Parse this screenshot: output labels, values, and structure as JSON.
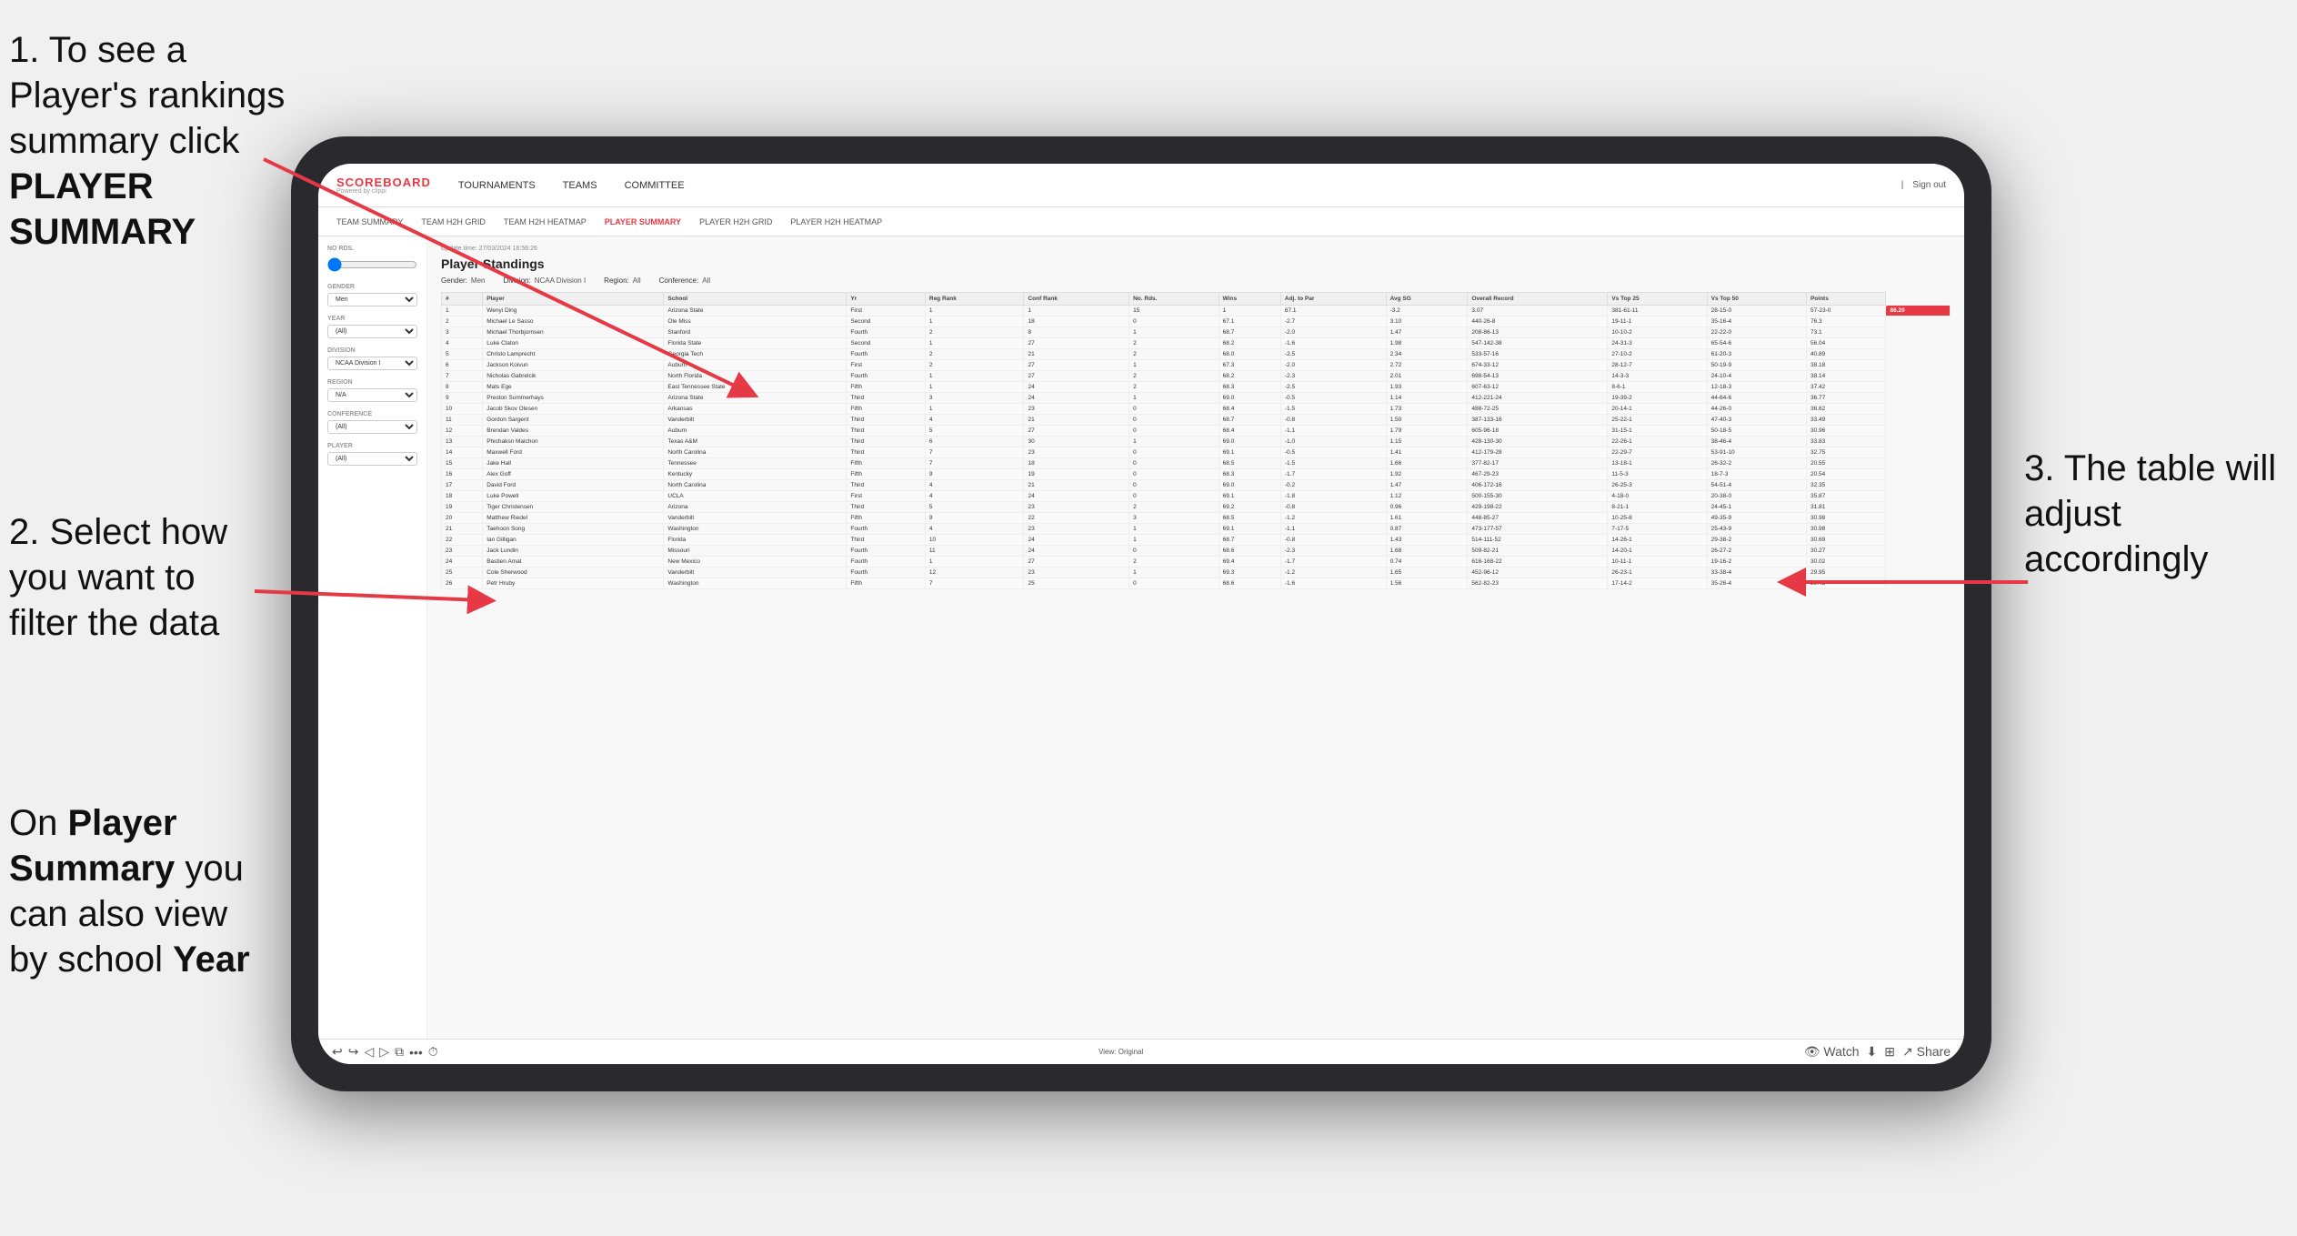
{
  "page": {
    "background": "#f0f0f0"
  },
  "annotations": {
    "top_left": {
      "number": "1.",
      "text": "To see a Player's rankings summary click ",
      "bold": "PLAYER SUMMARY"
    },
    "middle_left": {
      "number": "2.",
      "text": "Select how you want to filter the data"
    },
    "bottom_left": {
      "text": "On ",
      "bold1": "Player Summary",
      "text2": " you can also view by school ",
      "bold2": "Year"
    },
    "right": {
      "number": "3.",
      "text": "The table will adjust accordingly"
    }
  },
  "nav": {
    "logo_top": "SCOREBOARD",
    "logo_bottom": "Powered by clippi",
    "items": [
      "TOURNAMENTS",
      "TEAMS",
      "COMMITTEE"
    ],
    "right_items": [
      "Sign out"
    ],
    "separator": "|"
  },
  "sub_nav": {
    "items": [
      "TEAM SUMMARY",
      "TEAM H2H GRID",
      "TEAM H2H HEATMAP",
      "PLAYER SUMMARY",
      "PLAYER H2H GRID",
      "PLAYER H2H HEATMAP"
    ],
    "active": "PLAYER SUMMARY"
  },
  "sidebar": {
    "no_rds_label": "No Rds.",
    "gender_label": "Gender",
    "gender_value": "Men",
    "year_label": "Year",
    "year_value": "(All)",
    "division_label": "Division",
    "division_value": "NCAA Division I",
    "region_label": "Region",
    "region_value": "N/A",
    "conference_label": "Conference",
    "conference_value": "(All)",
    "player_label": "Player",
    "player_value": "(All)"
  },
  "main": {
    "update_time": "Update time: 27/03/2024 16:56:26",
    "title": "Player Standings",
    "filters": {
      "gender_label": "Gender:",
      "gender_value": "Men",
      "division_label": "Division:",
      "division_value": "NCAA Division I",
      "region_label": "Region:",
      "region_value": "All",
      "conference_label": "Conference:",
      "conference_value": "All"
    },
    "table": {
      "columns": [
        "#",
        "Player",
        "School",
        "Yr",
        "Reg Rank",
        "Conf Rank",
        "No. Rds.",
        "Wins",
        "Adj. to Par",
        "Avg SG",
        "Overall Record",
        "Vs Top 25",
        "Vs Top 50",
        "Points"
      ],
      "rows": [
        [
          "1",
          "Wenyi Ding",
          "Arizona State",
          "First",
          "1",
          "1",
          "15",
          "1",
          "67.1",
          "-3.2",
          "3.07",
          "381-61-11",
          "28-15-0",
          "57-23-0",
          "86.20"
        ],
        [
          "2",
          "Michael Le Sasso",
          "Ole Miss",
          "Second",
          "1",
          "18",
          "0",
          "67.1",
          "-2.7",
          "3.10",
          "440-26-8",
          "19-11-1",
          "35-16-4",
          "76.3"
        ],
        [
          "3",
          "Michael Thorbjornsen",
          "Stanford",
          "Fourth",
          "2",
          "8",
          "1",
          "68.7",
          "-2.0",
          "1.47",
          "208-86-13",
          "10-10-2",
          "22-22-0",
          "73.1"
        ],
        [
          "4",
          "Luke Claton",
          "Florida State",
          "Second",
          "1",
          "27",
          "2",
          "68.2",
          "-1.6",
          "1.98",
          "547-142-38",
          "24-31-3",
          "65-54-6",
          "56.04"
        ],
        [
          "5",
          "Christo Lamprecht",
          "Georgia Tech",
          "Fourth",
          "2",
          "21",
          "2",
          "68.0",
          "-2.5",
          "2.34",
          "533-57-16",
          "27-10-2",
          "61-20-3",
          "40.89"
        ],
        [
          "6",
          "Jackson Koivun",
          "Auburn",
          "First",
          "2",
          "27",
          "1",
          "67.3",
          "-2.0",
          "2.72",
          "674-33-12",
          "28-12-7",
          "50-19-9",
          "38.18"
        ],
        [
          "7",
          "Nicholas Gabrelcik",
          "North Florida",
          "Fourth",
          "1",
          "27",
          "2",
          "68.2",
          "-2.3",
          "2.01",
          "698-54-13",
          "14-3-3",
          "24-10-4",
          "38.14"
        ],
        [
          "8",
          "Mats Ege",
          "East Tennessee State",
          "Fifth",
          "1",
          "24",
          "2",
          "68.3",
          "-2.5",
          "1.93",
          "607-63-12",
          "8-6-1",
          "12-18-3",
          "37.42"
        ],
        [
          "9",
          "Preston Summerhays",
          "Arizona State",
          "Third",
          "3",
          "24",
          "1",
          "69.0",
          "-0.5",
          "1.14",
          "412-221-24",
          "19-39-2",
          "44-64-6",
          "36.77"
        ],
        [
          "10",
          "Jacob Skov Olesen",
          "Arkansas",
          "Fifth",
          "1",
          "23",
          "0",
          "68.4",
          "-1.5",
          "1.73",
          "488-72-25",
          "20-14-1",
          "44-26-0",
          "36.62"
        ],
        [
          "11",
          "Gordon Sargent",
          "Vanderbilt",
          "Third",
          "4",
          "21",
          "0",
          "68.7",
          "-0.8",
          "1.50",
          "387-133-16",
          "25-22-1",
          "47-40-3",
          "33.49"
        ],
        [
          "12",
          "Brendan Valdes",
          "Auburn",
          "Third",
          "5",
          "27",
          "0",
          "68.4",
          "-1.1",
          "1.79",
          "605-96-18",
          "31-15-1",
          "50-18-5",
          "30.96"
        ],
        [
          "13",
          "Phichaksn Maichon",
          "Texas A&M",
          "Third",
          "6",
          "30",
          "1",
          "69.0",
          "-1.0",
          "1.15",
          "428-130-30",
          "22-26-1",
          "38-46-4",
          "33.83"
        ],
        [
          "14",
          "Maxwell Ford",
          "North Carolina",
          "Third",
          "7",
          "23",
          "0",
          "69.1",
          "-0.5",
          "1.41",
          "412-179-28",
          "22-29-7",
          "53-91-10",
          "32.75"
        ],
        [
          "15",
          "Jake Hall",
          "Tennessee",
          "Fifth",
          "7",
          "18",
          "0",
          "68.5",
          "-1.5",
          "1.66",
          "377-82-17",
          "13-18-1",
          "26-32-2",
          "20.55"
        ],
        [
          "16",
          "Alex Goff",
          "Kentucky",
          "Fifth",
          "9",
          "19",
          "0",
          "68.3",
          "-1.7",
          "1.92",
          "467-29-23",
          "11-5-3",
          "18-7-3",
          "20.54"
        ],
        [
          "17",
          "David Ford",
          "North Carolina",
          "Third",
          "4",
          "21",
          "0",
          "69.0",
          "-0.2",
          "1.47",
          "406-172-16",
          "26-25-3",
          "54-51-4",
          "32.35"
        ],
        [
          "18",
          "Luke Powell",
          "UCLA",
          "First",
          "4",
          "24",
          "0",
          "69.1",
          "-1.8",
          "1.12",
          "500-155-30",
          "4-18-0",
          "20-38-0",
          "35.87"
        ],
        [
          "19",
          "Tiger Christensen",
          "Arizona",
          "Third",
          "5",
          "23",
          "2",
          "69.2",
          "-0.8",
          "0.96",
          "429-198-22",
          "8-21-1",
          "24-45-1",
          "31.81"
        ],
        [
          "20",
          "Matthew Riedel",
          "Vanderbilt",
          "Fifth",
          "9",
          "22",
          "3",
          "68.5",
          "-1.2",
          "1.61",
          "448-85-27",
          "10-25-8",
          "49-35-9",
          "30.98"
        ],
        [
          "21",
          "Taehoon Song",
          "Washington",
          "Fourth",
          "4",
          "23",
          "1",
          "69.1",
          "-1.1",
          "0.87",
          "473-177-57",
          "7-17-5",
          "25-43-9",
          "30.98"
        ],
        [
          "22",
          "Ian Gilligan",
          "Florida",
          "Third",
          "10",
          "24",
          "1",
          "68.7",
          "-0.8",
          "1.43",
          "514-111-52",
          "14-26-1",
          "29-38-2",
          "30.69"
        ],
        [
          "23",
          "Jack Lundin",
          "Missouri",
          "Fourth",
          "11",
          "24",
          "0",
          "68.6",
          "-2.3",
          "1.68",
          "509-82-21",
          "14-20-1",
          "26-27-2",
          "30.27"
        ],
        [
          "24",
          "Bastien Amat",
          "New Mexico",
          "Fourth",
          "1",
          "27",
          "2",
          "69.4",
          "-1.7",
          "0.74",
          "616-168-22",
          "10-11-1",
          "19-16-2",
          "30.02"
        ],
        [
          "25",
          "Cole Sherwood",
          "Vanderbilt",
          "Fourth",
          "12",
          "23",
          "1",
          "69.3",
          "-1.2",
          "1.65",
          "452-96-12",
          "26-23-1",
          "33-38-4",
          "29.95"
        ],
        [
          "26",
          "Petr Hruby",
          "Washington",
          "Fifth",
          "7",
          "25",
          "0",
          "68.6",
          "-1.6",
          "1.56",
          "562-82-23",
          "17-14-2",
          "35-26-4",
          "29.45"
        ]
      ]
    },
    "toolbar": {
      "view_label": "View: Original",
      "watch_label": "Watch",
      "share_label": "Share"
    }
  }
}
